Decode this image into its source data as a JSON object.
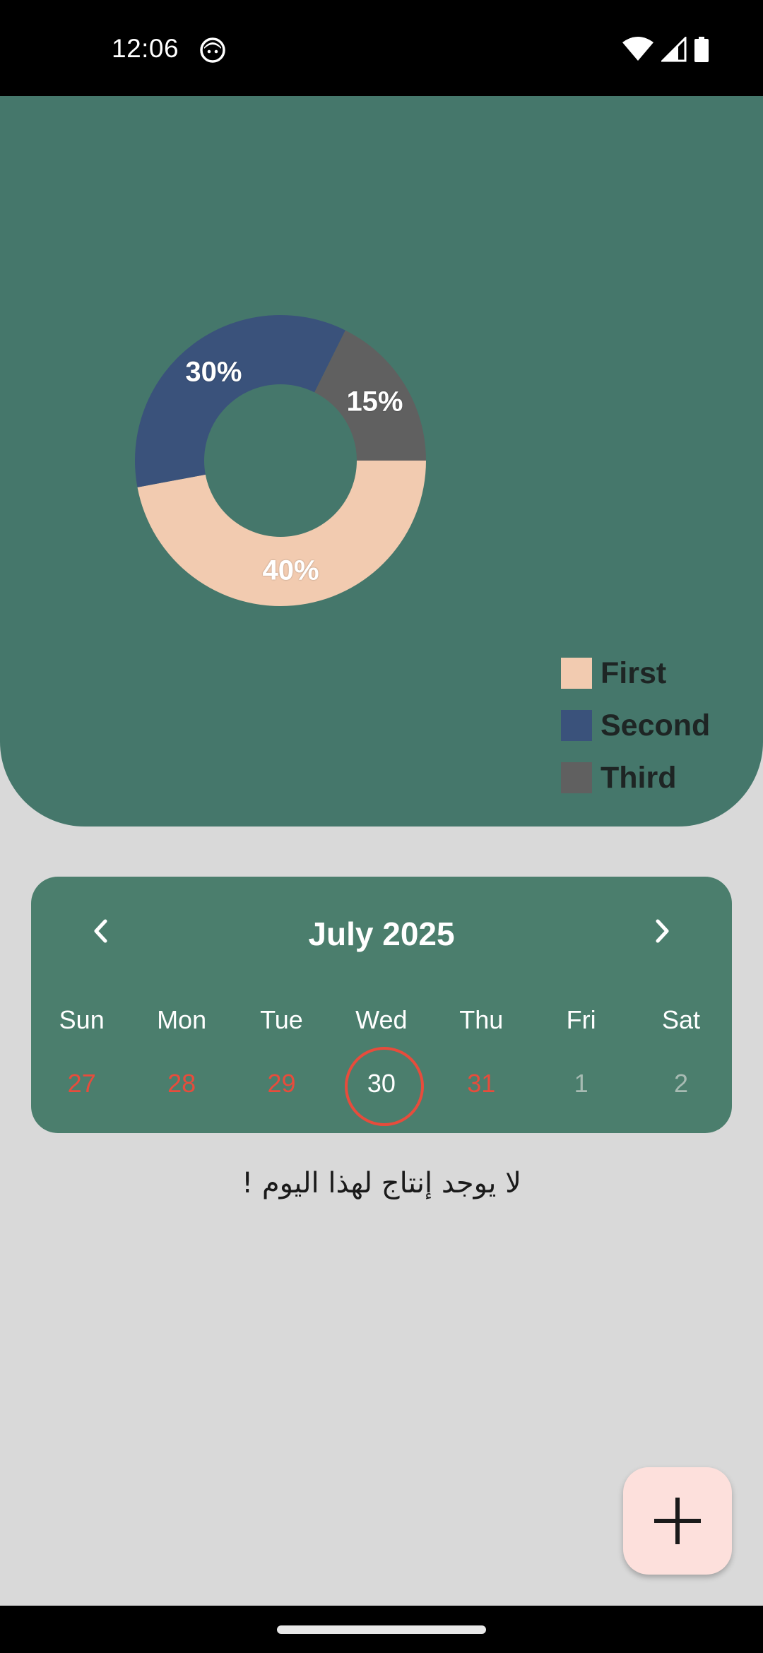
{
  "status_bar": {
    "time": "12:06",
    "icons": [
      "app-notification-icon",
      "wifi-icon",
      "signal-icon",
      "battery-icon"
    ]
  },
  "chart_data": {
    "type": "pie",
    "donut": true,
    "slices": [
      {
        "label": "First",
        "value": 40,
        "display": "40%",
        "color": "#f2cbb0"
      },
      {
        "label": "Second",
        "value": 30,
        "display": "30%",
        "color": "#3a527b"
      },
      {
        "label": "Third",
        "value": 15,
        "display": "15%",
        "color": "#606060"
      }
    ],
    "legend": [
      "First",
      "Second",
      "Third"
    ],
    "legend_position": "bottom-right"
  },
  "calendar": {
    "title": "July 2025",
    "weekdays": [
      "Sun",
      "Mon",
      "Tue",
      "Wed",
      "Thu",
      "Fri",
      "Sat"
    ],
    "days": [
      {
        "label": "27",
        "state": "red"
      },
      {
        "label": "28",
        "state": "red"
      },
      {
        "label": "29",
        "state": "red"
      },
      {
        "label": "30",
        "state": "selected"
      },
      {
        "label": "31",
        "state": "red"
      },
      {
        "label": "1",
        "state": "grey"
      },
      {
        "label": "2",
        "state": "grey"
      }
    ]
  },
  "empty_message": "لا يوجد إنتاج لهذا اليوم !",
  "colors": {
    "panel": "#45776b",
    "calendar": "#4b7e6d",
    "accent_red": "#e74c3c",
    "fab": "#fde0dc",
    "background": "#d9d9d9"
  }
}
